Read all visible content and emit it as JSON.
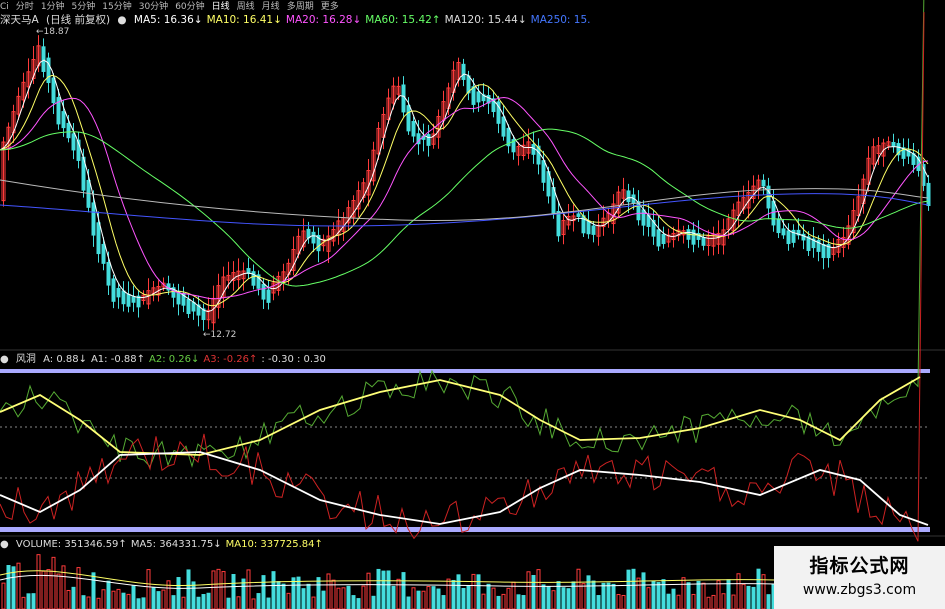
{
  "toolbar": {
    "tabs": [
      "Ci",
      "分时",
      "1分钟",
      "5分钟",
      "15分钟",
      "30分钟",
      "60分钟",
      "日线",
      "周线",
      "月线",
      "多周期",
      "更多"
    ],
    "active_tab": "日线"
  },
  "price_panel": {
    "stock_name": "深天马A",
    "period_label": "(日线 前复权)",
    "ma_items": [
      {
        "label": "MA5: 16.36↓",
        "color": "#ffffff"
      },
      {
        "label": "MA10: 16.41↓",
        "color": "#ffff66"
      },
      {
        "label": "MA20: 16.28↓",
        "color": "#ff55ff"
      },
      {
        "label": "MA60: 15.42↑",
        "color": "#66ff66"
      },
      {
        "label": "MA120: 15.44↓",
        "color": "#dddddd"
      },
      {
        "label": "MA250: 15.",
        "color": "#4477ff"
      }
    ],
    "high_label": "18.87",
    "low_label": "12.72"
  },
  "indicator_panel": {
    "name": "风洞",
    "items": [
      {
        "label": "A: 0.88↓",
        "color": "#dddddd"
      },
      {
        "label": "A1: -0.88↑",
        "color": "#dddddd"
      },
      {
        "label": "A2: 0.26↓",
        "color": "#66cc44"
      },
      {
        "label": "A3: -0.26↑",
        "color": "#dd3333"
      },
      {
        "label": ": -0.30 : 0.30",
        "color": "#dddddd"
      }
    ]
  },
  "volume_panel": {
    "items": [
      {
        "label": "VOLUME: 351346.59↑",
        "color": "#dddddd"
      },
      {
        "label": "MA5: 364331.75↓",
        "color": "#dddddd"
      },
      {
        "label": "MA10: 337725.84↑",
        "color": "#ffff66"
      }
    ]
  },
  "watermark": {
    "title": "指标公式网",
    "url": "www.zbgs3.com"
  },
  "colors": {
    "up": "#ff3b3b",
    "down": "#44dddd",
    "band": "#aaaaff"
  }
}
